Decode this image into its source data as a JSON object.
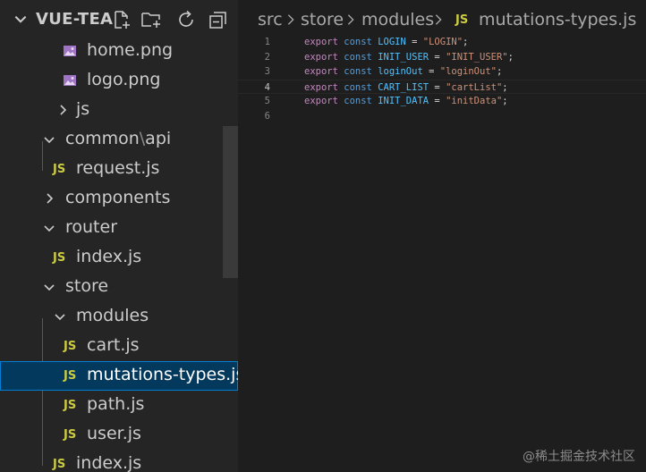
{
  "sidebar": {
    "title": "VUE-TEA",
    "actions": [
      "new-file-icon",
      "new-folder-icon",
      "refresh-icon",
      "collapse-all-icon"
    ],
    "items": [
      {
        "label": "home.png",
        "icon": "image-icon"
      },
      {
        "label": "logo.png",
        "icon": "image-icon"
      },
      {
        "label": "js",
        "icon": "chevron-right-icon"
      },
      {
        "label_a": "common",
        "label_sep": "\\",
        "label_b": "api",
        "icon": "chevron-down-icon"
      },
      {
        "label": "request.js",
        "icon": "JS"
      },
      {
        "label": "components",
        "icon": "chevron-right-icon"
      },
      {
        "label": "router",
        "icon": "chevron-down-icon"
      },
      {
        "label": "index.js",
        "icon": "JS"
      },
      {
        "label": "store",
        "icon": "chevron-down-icon"
      },
      {
        "label": "modules",
        "icon": "chevron-down-icon"
      },
      {
        "label": "cart.js",
        "icon": "JS"
      },
      {
        "label": "mutations-types.js",
        "icon": "JS",
        "selected": true
      },
      {
        "label": "path.js",
        "icon": "JS"
      },
      {
        "label": "user.js",
        "icon": "JS"
      },
      {
        "label": "index.js",
        "icon": "JS"
      }
    ]
  },
  "breadcrumb": {
    "parts": [
      "src",
      "store",
      "modules"
    ],
    "file_badge": "JS",
    "file": "mutations-types.js"
  },
  "editor": {
    "current_line": 4,
    "lines": [
      {
        "num": "1",
        "keyword": "export",
        "decl": "const",
        "name": "LOGIN",
        "eq": " = ",
        "value": "\"LOGIN\"",
        "end": ";"
      },
      {
        "num": "2",
        "keyword": "export",
        "decl": "const",
        "name": "INIT_USER",
        "eq": " = ",
        "value": "\"INIT_USER\"",
        "end": ";"
      },
      {
        "num": "3",
        "keyword": "export",
        "decl": "const",
        "name": "loginOut",
        "eq": " = ",
        "value": "\"loginOut\"",
        "end": ";"
      },
      {
        "num": "4",
        "keyword": "export",
        "decl": "const",
        "name": "CART_LIST",
        "eq": " = ",
        "value": "\"cartList\"",
        "end": ";"
      },
      {
        "num": "5",
        "keyword": "export",
        "decl": "const",
        "name": "INIT_DATA",
        "eq": " = ",
        "value": "\"initData\"",
        "end": ";"
      },
      {
        "num": "6"
      }
    ]
  },
  "watermark": "@稀土掘金技术社区",
  "colors": {
    "sidebar_bg": "#252526",
    "editor_bg": "#1e1e1e",
    "selection_bg": "#04395e",
    "selection_border": "#007fd4",
    "js_icon": "#cbcb41"
  }
}
